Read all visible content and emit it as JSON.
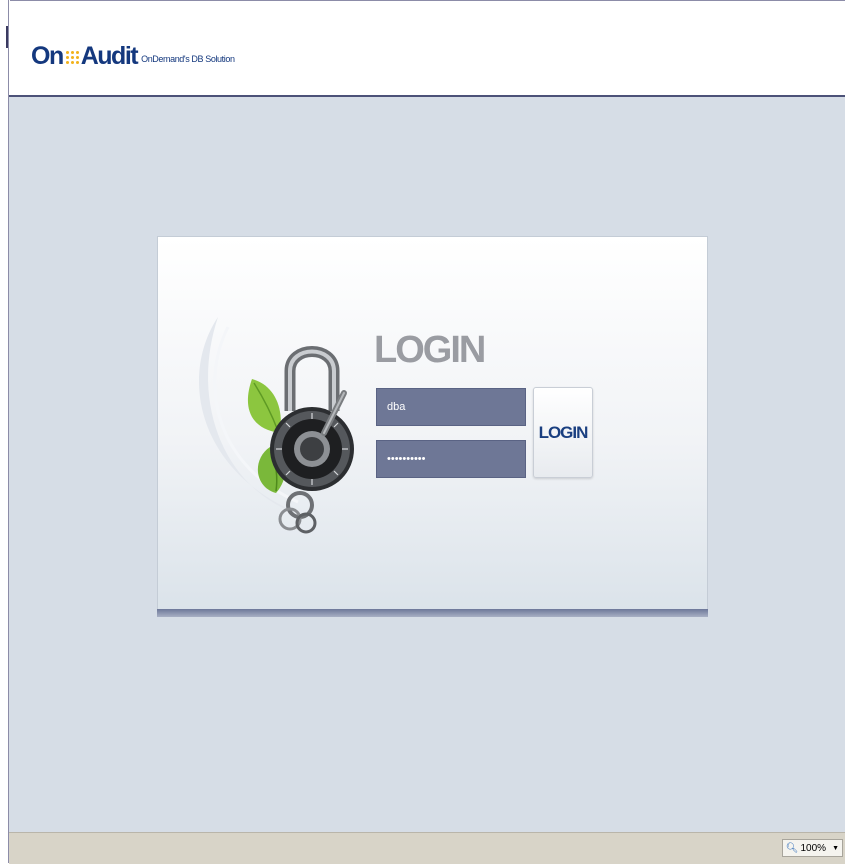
{
  "header": {
    "logo_on": "On",
    "logo_audit": "Audit",
    "logo_tagline": "OnDemand's DB Solution"
  },
  "login": {
    "title": "LOGIN",
    "username_value": "dba",
    "password_value": "••••••••••",
    "button_label": "LOGIN"
  },
  "status_bar": {
    "zoom_level": "100%"
  },
  "colors": {
    "brand_blue": "#14387e",
    "logo_dots": "#f2b21c",
    "field_bg": "#6e7796",
    "canvas_bg": "#d6dde6"
  },
  "icons": [
    "padlock-key-icon",
    "leaf-icon",
    "zoom-icon"
  ]
}
